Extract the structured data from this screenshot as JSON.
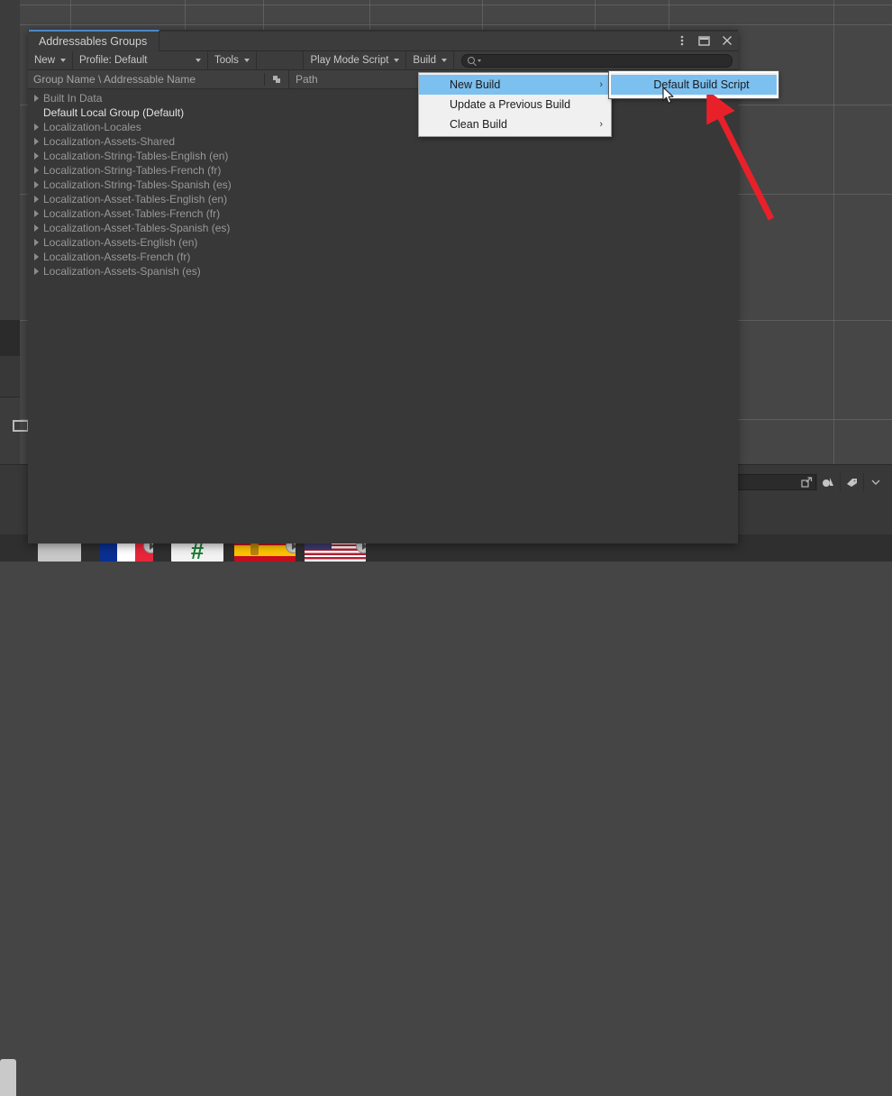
{
  "window": {
    "tab_title": "Addressables Groups",
    "controls": [
      {
        "name": "kebab-menu-icon",
        "glyph": "⋮"
      },
      {
        "name": "maximize-icon",
        "glyph": "□"
      },
      {
        "name": "close-icon",
        "glyph": "✕"
      }
    ]
  },
  "toolbar": {
    "new_label": "New",
    "profile_label": "Profile: Default",
    "tools_label": "Tools",
    "play_mode_script_label": "Play Mode Script",
    "build_label": "Build",
    "search_placeholder": "",
    "search_value": "",
    "search_icon": "search-icon"
  },
  "columns": {
    "name_header": "Group Name \\ Addressable Name",
    "path_header": "Path",
    "sort_icon": "column-options-icon"
  },
  "tree": {
    "rows": [
      {
        "label": "Built In Data",
        "expandable": true,
        "bright": false
      },
      {
        "label": "Default Local Group (Default)",
        "expandable": false,
        "bright": true
      },
      {
        "label": "Localization-Locales",
        "expandable": true,
        "bright": false
      },
      {
        "label": "Localization-Assets-Shared",
        "expandable": true,
        "bright": false
      },
      {
        "label": "Localization-String-Tables-English (en)",
        "expandable": true,
        "bright": false
      },
      {
        "label": "Localization-String-Tables-French (fr)",
        "expandable": true,
        "bright": false
      },
      {
        "label": "Localization-String-Tables-Spanish (es)",
        "expandable": true,
        "bright": false
      },
      {
        "label": "Localization-Asset-Tables-English (en)",
        "expandable": true,
        "bright": false
      },
      {
        "label": "Localization-Asset-Tables-French (fr)",
        "expandable": true,
        "bright": false
      },
      {
        "label": "Localization-Asset-Tables-Spanish (es)",
        "expandable": true,
        "bright": false
      },
      {
        "label": "Localization-Assets-English (en)",
        "expandable": true,
        "bright": false
      },
      {
        "label": "Localization-Assets-French (fr)",
        "expandable": true,
        "bright": false
      },
      {
        "label": "Localization-Assets-Spanish (es)",
        "expandable": true,
        "bright": false
      }
    ]
  },
  "build_menu": {
    "items": [
      {
        "label": "New Build",
        "has_submenu": true,
        "selected": true,
        "arrow": "›"
      },
      {
        "label": "Update a Previous Build",
        "has_submenu": false,
        "selected": false,
        "arrow": ""
      },
      {
        "label": "Clean Build",
        "has_submenu": true,
        "selected": false,
        "arrow": "›"
      }
    ]
  },
  "build_submenu": {
    "items": [
      {
        "label": "Default Build Script",
        "selected": true
      }
    ]
  },
  "annotation": {
    "arrow_name": "red-pointer-arrow",
    "color": "#e8202a"
  },
  "colors": {
    "menu_highlight": "#7cc0f0",
    "menu_background": "#f0f0f0",
    "panel_background": "#383838",
    "tab_accent": "#4b88c8",
    "text_dim": "#989898"
  },
  "taskbar": {
    "items": [
      {
        "name": "taskbar-item-blank",
        "kind": "blank"
      },
      {
        "name": "taskbar-item-french-flag",
        "kind": "flag-fr",
        "badge": true
      },
      {
        "name": "taskbar-item-hash",
        "kind": "hash"
      },
      {
        "name": "taskbar-item-spanish-flag",
        "kind": "flag-es",
        "badge": true
      },
      {
        "name": "taskbar-item-us-flag",
        "kind": "flag-us",
        "badge": true
      }
    ]
  }
}
